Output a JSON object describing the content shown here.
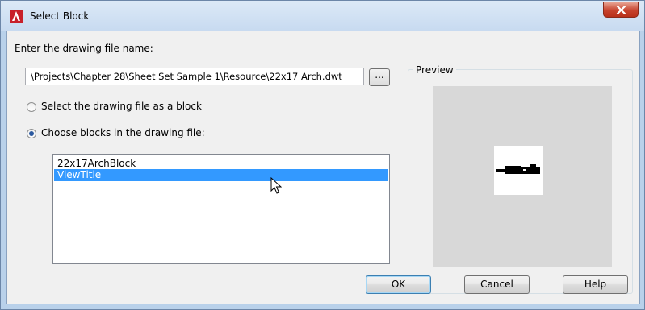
{
  "window": {
    "title": "Select Block",
    "close_label": "x"
  },
  "file": {
    "prompt_label": "Enter the drawing file name:",
    "path_value": "\\Projects\\Chapter 28\\Sheet Set Sample 1\\Resource\\22x17 Arch.dwt",
    "browse_label": "..."
  },
  "options": {
    "as_block_label": "Select the drawing file as a block",
    "choose_blocks_label": "Choose blocks in the drawing file:",
    "selected": "choose_blocks"
  },
  "blocks": {
    "items": [
      {
        "label": "22x17ArchBlock",
        "selected": false
      },
      {
        "label": "ViewTitle",
        "selected": true
      }
    ]
  },
  "preview": {
    "label": "Preview"
  },
  "buttons": {
    "ok_label": "OK",
    "cancel_label": "Cancel",
    "help_label": "Help"
  },
  "colors": {
    "selection": "#3399ff",
    "titlebar": "#c7daf0",
    "close_button": "#c7432d",
    "app_icon": "#c8202a"
  }
}
